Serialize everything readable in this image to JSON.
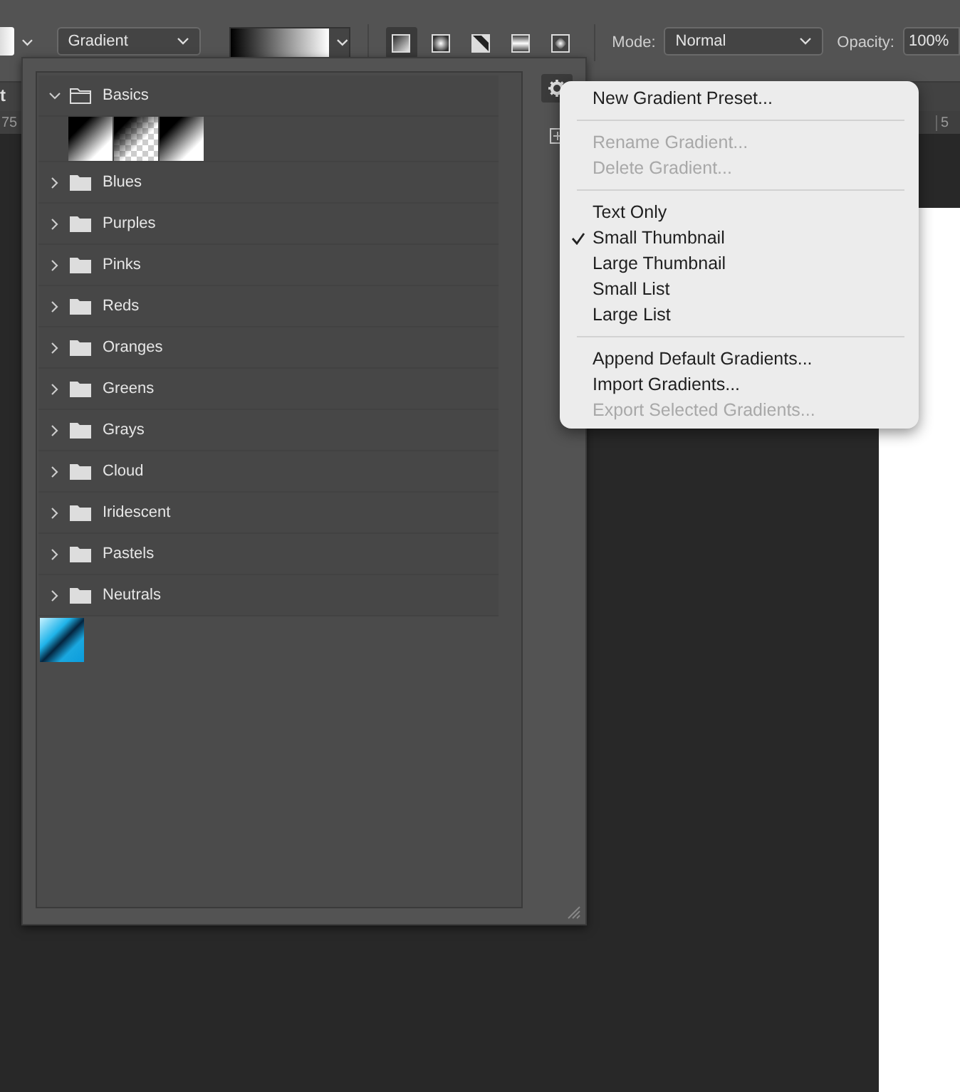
{
  "toolbar": {
    "gradient_type": "Gradient",
    "shape_buttons": [
      {
        "kind": "linear",
        "selected": true
      },
      {
        "kind": "radial",
        "selected": false
      },
      {
        "kind": "angle",
        "selected": false
      },
      {
        "kind": "reflected",
        "selected": false
      },
      {
        "kind": "diamond",
        "selected": false
      }
    ],
    "mode_label": "Mode:",
    "mode": "Normal",
    "opacity_label": "Opacity:",
    "opacity": "100%"
  },
  "document": {
    "tab_text": "t",
    "ruler_labels": [
      "75",
      "5"
    ]
  },
  "panel": {
    "groups": [
      {
        "name": "Basics",
        "expanded": true,
        "gradients": [
          {
            "kind": "black-white"
          },
          {
            "kind": "black-transparent"
          },
          {
            "kind": "black-white"
          }
        ]
      },
      {
        "name": "Blues",
        "expanded": false
      },
      {
        "name": "Purples",
        "expanded": false
      },
      {
        "name": "Pinks",
        "expanded": false
      },
      {
        "name": "Reds",
        "expanded": false
      },
      {
        "name": "Oranges",
        "expanded": false
      },
      {
        "name": "Greens",
        "expanded": false
      },
      {
        "name": "Grays",
        "expanded": false
      },
      {
        "name": "Cloud",
        "expanded": false
      },
      {
        "name": "Iridescent",
        "expanded": false
      },
      {
        "name": "Pastels",
        "expanded": false
      },
      {
        "name": "Neutrals",
        "expanded": false
      }
    ],
    "loose_gradients": [
      {
        "kind": "blue"
      }
    ]
  },
  "menu": {
    "sections": [
      [
        {
          "label": "New Gradient Preset...",
          "disabled": false
        }
      ],
      [
        {
          "label": "Rename Gradient...",
          "disabled": true
        },
        {
          "label": "Delete Gradient...",
          "disabled": true
        }
      ],
      [
        {
          "label": "Text Only",
          "disabled": false,
          "checked": false
        },
        {
          "label": "Small Thumbnail",
          "disabled": false,
          "checked": true
        },
        {
          "label": "Large Thumbnail",
          "disabled": false,
          "checked": false
        },
        {
          "label": "Small List",
          "disabled": false,
          "checked": false
        },
        {
          "label": "Large List",
          "disabled": false,
          "checked": false
        }
      ],
      [
        {
          "label": "Append Default Gradients...",
          "disabled": false
        },
        {
          "label": "Import Gradients...",
          "disabled": false
        },
        {
          "label": "Export Selected Gradients...",
          "disabled": true
        }
      ]
    ]
  }
}
